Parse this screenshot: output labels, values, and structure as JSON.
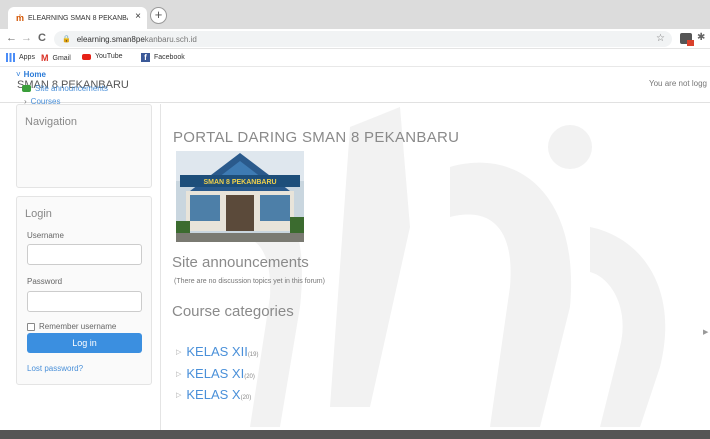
{
  "browser": {
    "tab_title": "ELEARNING SMAN 8 PEKANBAR",
    "tab_close": "×",
    "new_tab": "+",
    "url_domain": "elearning.sman8pe",
    "url_path": "kanbaru.sch.id",
    "back": "←",
    "forward": "→",
    "reload": "C",
    "bookmarks": [
      "Apps",
      "Gmail",
      "YouTube",
      "Facebook"
    ]
  },
  "header": {
    "site_name": "SMAN 8 PEKANBARU",
    "login_info": "You are not logg"
  },
  "navigation": {
    "title": "Navigation",
    "home": "Home",
    "site_announcements": "Site announcements",
    "courses": "Courses"
  },
  "login": {
    "title": "Login",
    "username_label": "Username",
    "password_label": "Password",
    "remember_label": "Remember username",
    "button": "Log in",
    "lost_password": "Lost password?"
  },
  "main": {
    "portal_title": "PORTAL DARING SMAN 8 PEKANBARU",
    "school_sign": "SMAN 8 PEKANBARU",
    "announcements_heading": "Site announcements",
    "no_topics": "(There are no discussion topics yet in this forum)",
    "categories_heading": "Course categories",
    "categories": [
      {
        "name": "KELAS XII",
        "count": "(19)"
      },
      {
        "name": "KELAS XI",
        "count": "(20)"
      },
      {
        "name": "KELAS X",
        "count": "(20)"
      }
    ]
  },
  "colors": {
    "link": "#4a90d9",
    "button": "#3b8fe0",
    "heading": "#8a8a8a"
  }
}
